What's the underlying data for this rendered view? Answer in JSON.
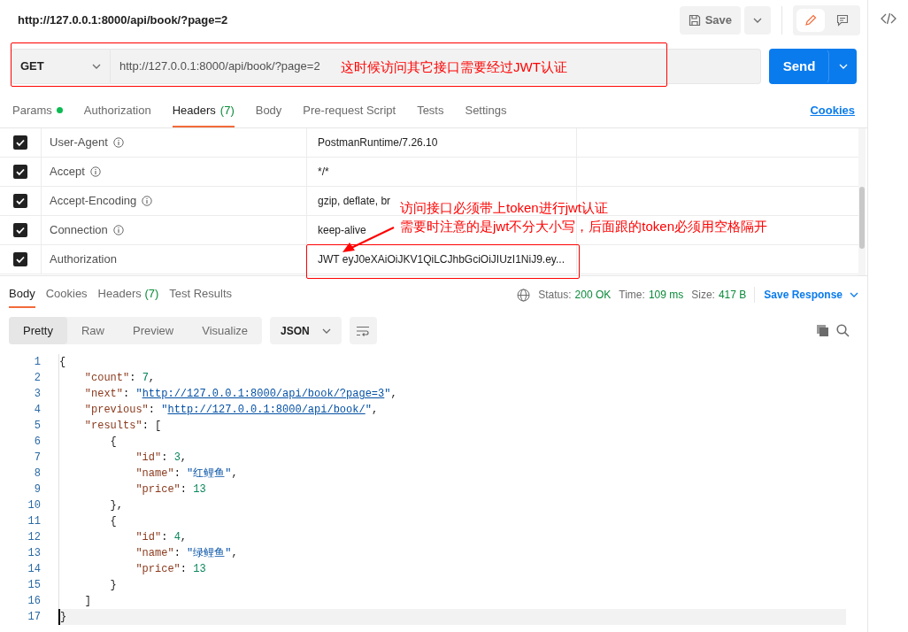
{
  "request_title": "http://127.0.0.1:8000/api/book/?page=2",
  "save_button": "Save",
  "request": {
    "method": "GET",
    "url": "http://127.0.0.1:8000/api/book/?page=2",
    "send": "Send",
    "note": "这时候访问其它接口需要经过JWT认证"
  },
  "request_tabs": [
    {
      "label": "Params",
      "dot": true,
      "selected": false
    },
    {
      "label": "Authorization",
      "dot": false,
      "selected": false
    },
    {
      "label": "Headers",
      "count": "(7)",
      "dot": false,
      "selected": true
    },
    {
      "label": "Body",
      "dot": false,
      "selected": false
    },
    {
      "label": "Pre-request Script",
      "dot": false,
      "selected": false
    },
    {
      "label": "Tests",
      "dot": false,
      "selected": false
    },
    {
      "label": "Settings",
      "dot": false,
      "selected": false
    }
  ],
  "cookies_link": "Cookies",
  "headers": [
    {
      "key": "User-Agent",
      "info": true,
      "value": "PostmanRuntime/7.26.10",
      "checked": true
    },
    {
      "key": "Accept",
      "info": true,
      "value": "*/*",
      "checked": true
    },
    {
      "key": "Accept-Encoding",
      "info": true,
      "value": "gzip, deflate, br",
      "checked": true
    },
    {
      "key": "Connection",
      "info": true,
      "value": "keep-alive",
      "checked": true
    },
    {
      "key": "Authorization",
      "info": false,
      "value": "JWT eyJ0eXAiOiJKV1QiLCJhbGciOiJIUzI1NiJ9.ey...",
      "checked": true
    }
  ],
  "header_note": [
    "访问接口必须带上token进行jwt认证",
    "需要时注意的是jwt不分大小写，后面跟的token必须用空格隔开"
  ],
  "response_tabs": [
    {
      "label": "Body",
      "selected": true
    },
    {
      "label": "Cookies",
      "selected": false
    },
    {
      "label": "Headers",
      "count": "(7)",
      "selected": false
    },
    {
      "label": "Test Results",
      "selected": false
    }
  ],
  "response_meta": [
    {
      "label": "Status:",
      "value": "200 OK"
    },
    {
      "label": "Time:",
      "value": "109 ms"
    },
    {
      "label": "Size:",
      "value": "417 B"
    }
  ],
  "save_response": "Save Response",
  "view_modes": [
    {
      "label": "Pretty",
      "selected": true
    },
    {
      "label": "Raw",
      "selected": false
    },
    {
      "label": "Preview",
      "selected": false
    },
    {
      "label": "Visualize",
      "selected": false
    }
  ],
  "format": "JSON",
  "code_lines": [
    {
      "number": "1",
      "tokens": [
        {
          "kind": "punct",
          "text": "{"
        }
      ]
    },
    {
      "number": "2",
      "tokens": [
        {
          "kind": "key",
          "text": "    \"count\""
        },
        {
          "kind": "punct",
          "text": ": "
        },
        {
          "kind": "num",
          "text": "7"
        },
        {
          "kind": "punct",
          "text": ","
        }
      ]
    },
    {
      "number": "3",
      "tokens": [
        {
          "kind": "key",
          "text": "    \"next\""
        },
        {
          "kind": "punct",
          "text": ": "
        },
        {
          "kind": "str",
          "text": "\""
        },
        {
          "kind": "link",
          "text": "http://127.0.0.1:8000/api/book/?page=3"
        },
        {
          "kind": "str",
          "text": "\""
        },
        {
          "kind": "punct",
          "text": ","
        }
      ]
    },
    {
      "number": "4",
      "tokens": [
        {
          "kind": "key",
          "text": "    \"previous\""
        },
        {
          "kind": "punct",
          "text": ": "
        },
        {
          "kind": "str",
          "text": "\""
        },
        {
          "kind": "link",
          "text": "http://127.0.0.1:8000/api/book/"
        },
        {
          "kind": "str",
          "text": "\""
        },
        {
          "kind": "punct",
          "text": ","
        }
      ]
    },
    {
      "number": "5",
      "tokens": [
        {
          "kind": "key",
          "text": "    \"results\""
        },
        {
          "kind": "punct",
          "text": ": ["
        }
      ]
    },
    {
      "number": "6",
      "tokens": [
        {
          "kind": "punct",
          "text": "        {"
        }
      ]
    },
    {
      "number": "7",
      "tokens": [
        {
          "kind": "key",
          "text": "            \"id\""
        },
        {
          "kind": "punct",
          "text": ": "
        },
        {
          "kind": "num",
          "text": "3"
        },
        {
          "kind": "punct",
          "text": ","
        }
      ]
    },
    {
      "number": "8",
      "tokens": [
        {
          "kind": "key",
          "text": "            \"name\""
        },
        {
          "kind": "punct",
          "text": ": "
        },
        {
          "kind": "str",
          "text": "\"红鲤鱼\""
        },
        {
          "kind": "punct",
          "text": ","
        }
      ]
    },
    {
      "number": "9",
      "tokens": [
        {
          "kind": "key",
          "text": "            \"price\""
        },
        {
          "kind": "punct",
          "text": ": "
        },
        {
          "kind": "num",
          "text": "13"
        }
      ]
    },
    {
      "number": "10",
      "tokens": [
        {
          "kind": "punct",
          "text": "        },"
        }
      ]
    },
    {
      "number": "11",
      "tokens": [
        {
          "kind": "punct",
          "text": "        {"
        }
      ]
    },
    {
      "number": "12",
      "tokens": [
        {
          "kind": "key",
          "text": "            \"id\""
        },
        {
          "kind": "punct",
          "text": ": "
        },
        {
          "kind": "num",
          "text": "4"
        },
        {
          "kind": "punct",
          "text": ","
        }
      ]
    },
    {
      "number": "13",
      "tokens": [
        {
          "kind": "key",
          "text": "            \"name\""
        },
        {
          "kind": "punct",
          "text": ": "
        },
        {
          "kind": "str",
          "text": "\"绿鲤鱼\""
        },
        {
          "kind": "punct",
          "text": ","
        }
      ]
    },
    {
      "number": "14",
      "tokens": [
        {
          "kind": "key",
          "text": "            \"price\""
        },
        {
          "kind": "punct",
          "text": ": "
        },
        {
          "kind": "num",
          "text": "13"
        }
      ]
    },
    {
      "number": "15",
      "tokens": [
        {
          "kind": "punct",
          "text": "        }"
        }
      ]
    },
    {
      "number": "16",
      "tokens": [
        {
          "kind": "punct",
          "text": "    ]"
        }
      ]
    },
    {
      "number": "17",
      "current": true,
      "tokens": [
        {
          "kind": "punct",
          "text": "}"
        }
      ]
    }
  ]
}
